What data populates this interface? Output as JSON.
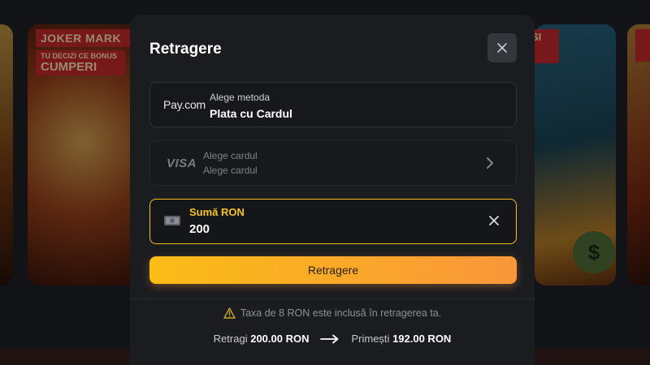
{
  "background": {
    "promo_title": "JOKER MARK",
    "promo_sub_small": "TU DECIZI CE BONUS",
    "promo_sub_big": "CUMPERI",
    "promo_right_tag": "SI",
    "money_symbol": "$"
  },
  "modal": {
    "title": "Retragere",
    "close_icon": "close-icon",
    "method": {
      "logo": "Pay.com",
      "label": "Alege metoda",
      "value": "Plata cu Cardul"
    },
    "card": {
      "logo": "VISA",
      "label": "Alege cardul",
      "value": "Alege cardul"
    },
    "amount": {
      "label": "Sumă RON",
      "value": "200"
    },
    "submit_label": "Retragere",
    "fee_notice": "Taxa de 8 RON este inclusă în retragerea ta.",
    "summary": {
      "withdraw_label": "Retragi",
      "withdraw_amount": "200.00 RON",
      "receive_label": "Primești",
      "receive_amount": "192.00 RON"
    }
  },
  "colors": {
    "accent": "#f5c518",
    "button_gradient_start": "#fbbd16",
    "button_gradient_end": "#f9963a",
    "modal_bg": "#1b1c20",
    "warning": "#c9a227"
  }
}
